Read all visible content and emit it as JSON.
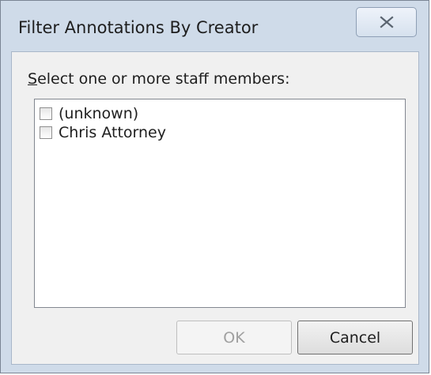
{
  "window": {
    "title": "Filter Annotations By Creator",
    "close_icon": "close-icon"
  },
  "dialog": {
    "instruction_mnemonic": "S",
    "instruction_rest": "elect one or more staff members:",
    "staff_items": [
      {
        "label": "(unknown)",
        "checked": false
      },
      {
        "label": "Chris Attorney",
        "checked": false
      }
    ],
    "ok_label": "OK",
    "ok_enabled": false,
    "cancel_label": "Cancel"
  }
}
